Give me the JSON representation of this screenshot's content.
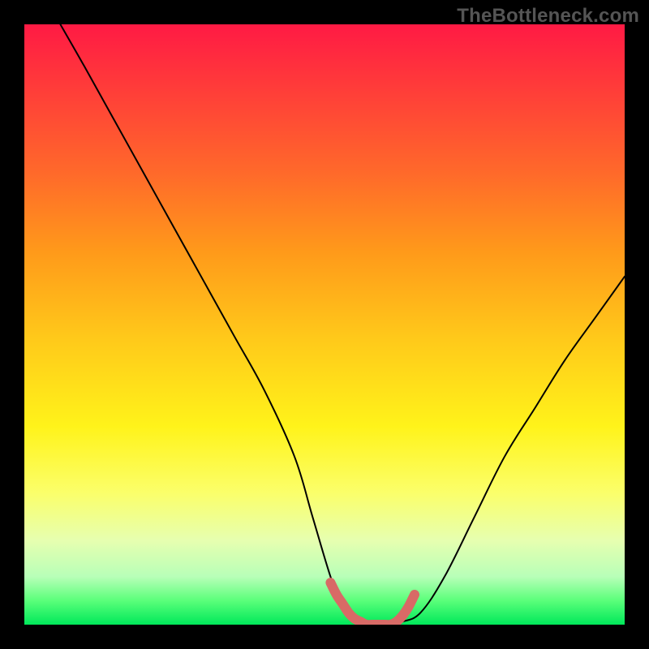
{
  "watermark": "TheBottleneck.com",
  "chart_data": {
    "type": "line",
    "title": "",
    "xlabel": "",
    "ylabel": "",
    "xlim": [
      0,
      100
    ],
    "ylim": [
      0,
      100
    ],
    "grid": false,
    "legend": false,
    "series": [
      {
        "name": "bottleneck-curve",
        "color": "#000000",
        "x": [
          6,
          10,
          15,
          20,
          25,
          30,
          35,
          40,
          45,
          48,
          51,
          53,
          55,
          57,
          59,
          61,
          63,
          66,
          70,
          75,
          80,
          85,
          90,
          95,
          100
        ],
        "y": [
          100,
          93,
          84,
          75,
          66,
          57,
          48,
          39,
          28,
          18,
          8,
          3,
          1,
          0,
          0,
          0,
          0.5,
          2,
          8,
          18,
          28,
          36,
          44,
          51,
          58
        ]
      },
      {
        "name": "optimal-floor",
        "color": "#d86a66",
        "x": [
          51,
          52,
          53,
          54,
          55,
          56,
          57,
          58,
          59,
          60,
          61,
          62,
          63,
          64,
          65
        ],
        "y": [
          7,
          5,
          3.5,
          2,
          1,
          0.5,
          0,
          0,
          0,
          0,
          0,
          0.5,
          1.5,
          3,
          5
        ]
      }
    ]
  }
}
